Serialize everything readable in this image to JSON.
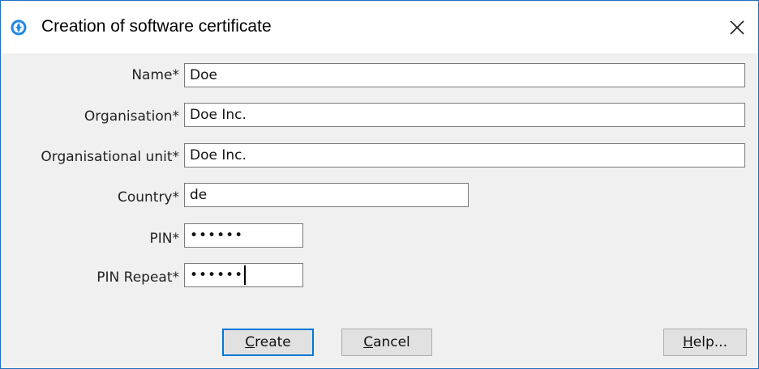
{
  "window": {
    "title": "Creation of software certificate",
    "icon": "app-globe-icon",
    "close_icon": "close-icon"
  },
  "form": {
    "name": {
      "label": "Name*",
      "value": "Doe"
    },
    "organisation": {
      "label": "Organisation*",
      "value": "Doe Inc."
    },
    "org_unit": {
      "label": "Organisational unit*",
      "value": "Doe Inc."
    },
    "country": {
      "label": "Country*",
      "value": "de"
    },
    "pin": {
      "label": "PIN*",
      "value": "••••••"
    },
    "pin_repeat": {
      "label": "PIN Repeat*",
      "value": "••••••"
    }
  },
  "buttons": {
    "create": {
      "mnemonic": "C",
      "rest": "reate"
    },
    "cancel": {
      "mnemonic": "C",
      "rest": "ancel"
    },
    "help": {
      "mnemonic": "H",
      "rest": "elp..."
    }
  },
  "colors": {
    "accent": "#0078d7",
    "window_border": "#1f6fbf",
    "background": "#f0f0f0"
  }
}
